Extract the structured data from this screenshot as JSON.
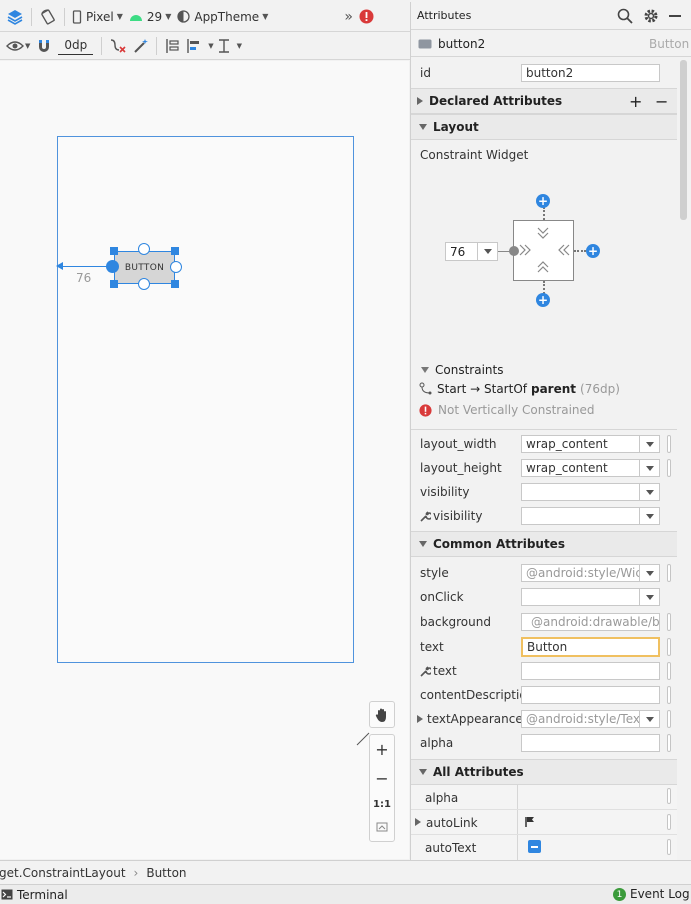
{
  "toolbar": {
    "device": "Pixel",
    "api": "29",
    "theme": "AppTheme",
    "margin": "0dp",
    "overflow": "»"
  },
  "canvas": {
    "button_text": "BUTTON",
    "constraint_value": "76"
  },
  "attributes": {
    "panel_title": "Attributes",
    "component_name": "button2",
    "component_type": "Button",
    "id_label": "id",
    "id_value": "button2",
    "declared_section": "Declared Attributes",
    "layout_section": "Layout",
    "constraint_widget_label": "Constraint Widget",
    "margin_value": "76",
    "constraints_label": "Constraints",
    "constraint_start_prefix": "Start → StartOf",
    "constraint_start_target": "parent",
    "constraint_start_dp": "(76dp)",
    "constraint_warning": "Not Vertically Constrained",
    "layout_rows": [
      {
        "label": "layout_width",
        "value": "wrap_content"
      },
      {
        "label": "layout_height",
        "value": "wrap_content"
      },
      {
        "label": "visibility",
        "value": ""
      },
      {
        "label": "visibility",
        "value": ""
      }
    ],
    "common_section": "Common Attributes",
    "common_rows": [
      {
        "label": "style",
        "value": "@android:style/Wic"
      },
      {
        "label": "onClick",
        "value": ""
      },
      {
        "label": "background",
        "value": "@android:drawable/b"
      },
      {
        "label": "text",
        "value": "Button"
      },
      {
        "label": "text",
        "value": ""
      },
      {
        "label": "contentDescription",
        "value": ""
      },
      {
        "label": "textAppearance",
        "value": "@android:style/Tex"
      },
      {
        "label": "alpha",
        "value": ""
      }
    ],
    "all_section": "All Attributes",
    "all_rows": [
      {
        "label": "alpha"
      },
      {
        "label": "autoLink"
      },
      {
        "label": "autoText"
      }
    ]
  },
  "zoom": {
    "plus": "+",
    "minus": "−",
    "actual": "1:1"
  },
  "breadcrumb": {
    "parent": "get.ConstraintLayout",
    "sep": "›",
    "current": "Button"
  },
  "status": {
    "terminal": "Terminal",
    "event_count": "1",
    "event_log": "Event Log"
  },
  "colors": {
    "accent": "#2f86e0",
    "error": "#d93a3a",
    "focus": "#f0c060"
  }
}
